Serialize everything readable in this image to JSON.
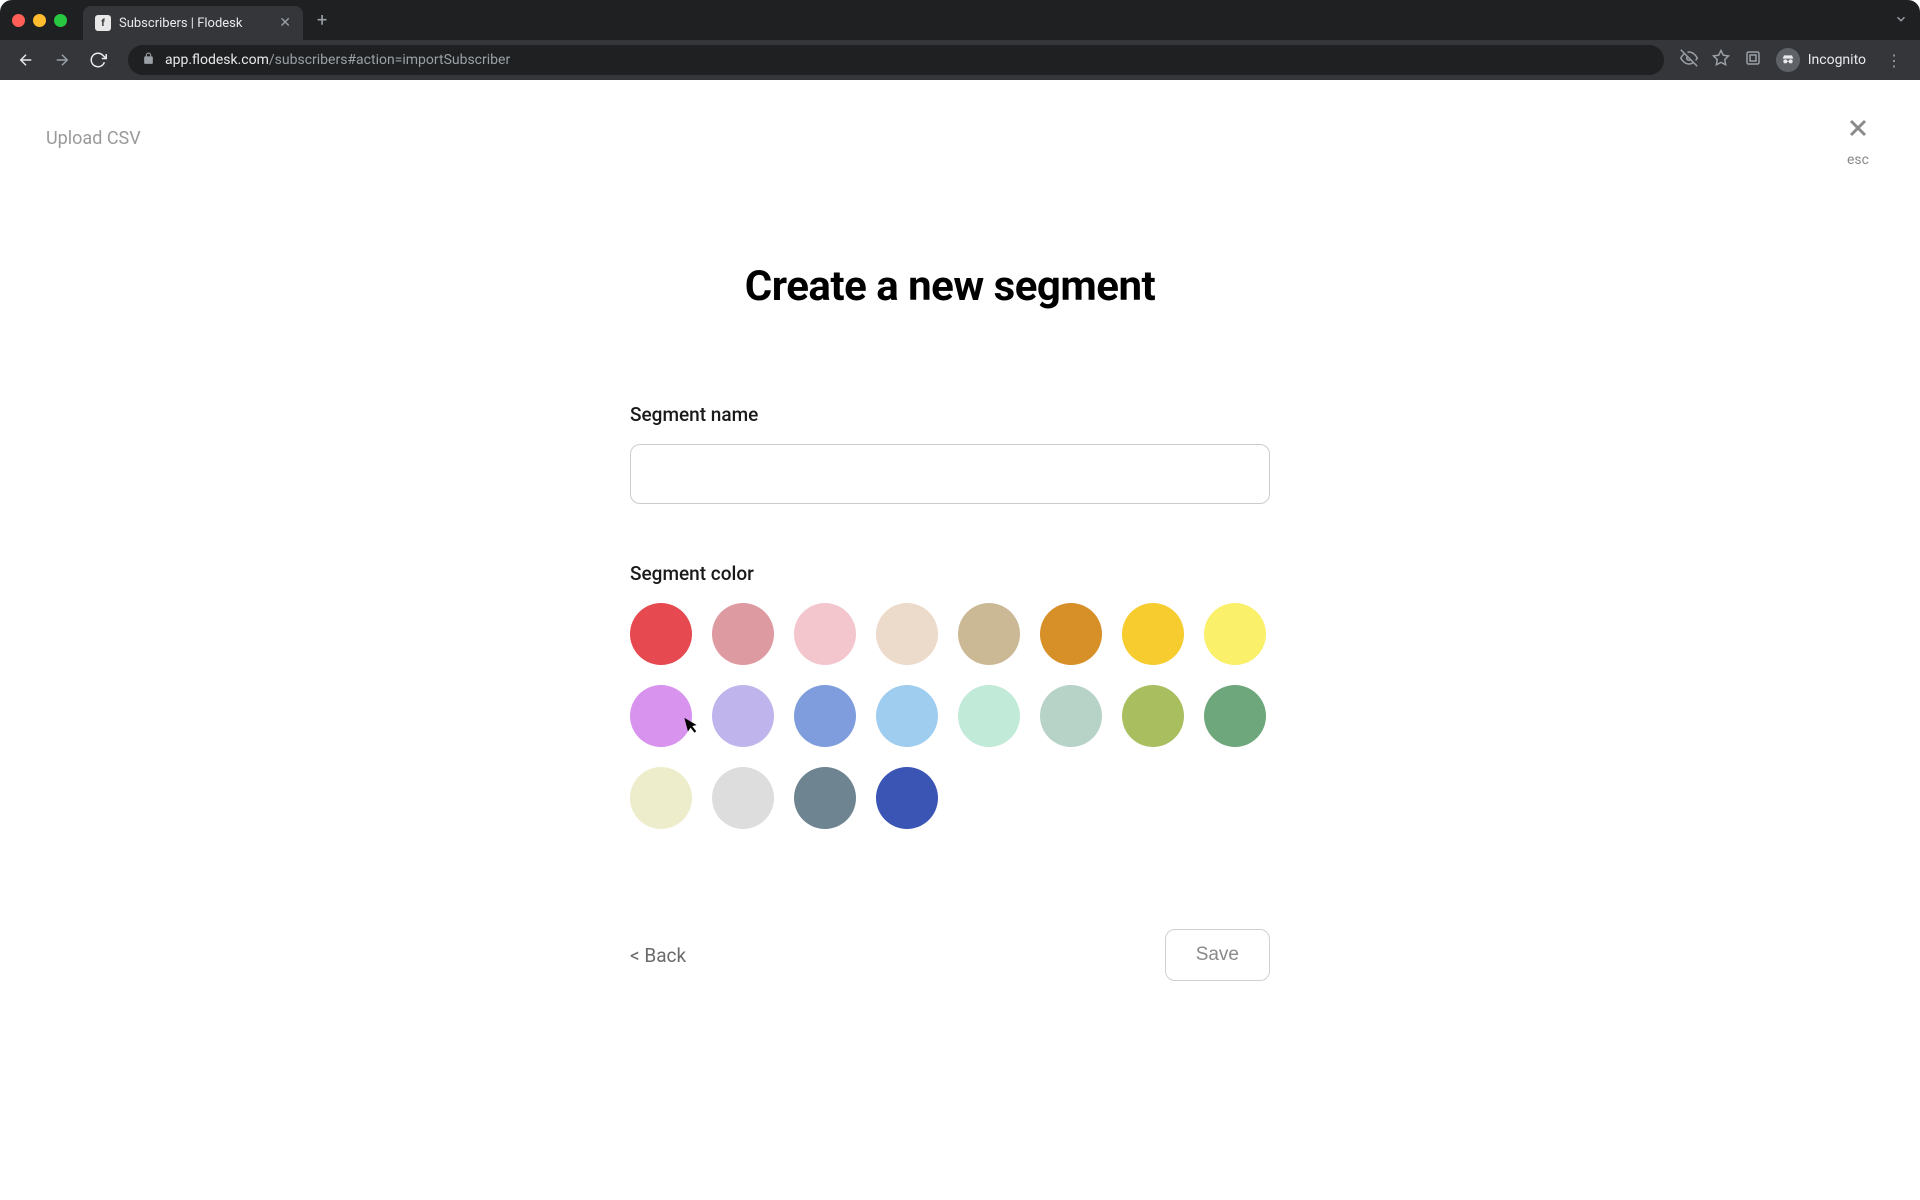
{
  "browser": {
    "tab_title": "Subscribers | Flodesk",
    "url_host": "app.flodesk.com",
    "url_path": "/subscribers#action=importSubscriber",
    "incognito_label": "Incognito"
  },
  "page": {
    "breadcrumb": "Upload CSV",
    "close_hint": "esc",
    "heading": "Create a new segment",
    "name_label": "Segment name",
    "name_value": "",
    "color_label": "Segment color",
    "colors": [
      "#e64a50",
      "#dd9aa0",
      "#f3c6ce",
      "#ecdacb",
      "#cbb995",
      "#d78f28",
      "#f6cc2f",
      "#faf06a",
      "#d893ee",
      "#bfb4ec",
      "#7f9ddd",
      "#9fcdef",
      "#c1ead8",
      "#b7d2c6",
      "#a9bf5f",
      "#6ea77c",
      "#edeccb",
      "#dddddd",
      "#6e8491",
      "#3b55b4"
    ],
    "back_label": "< Back",
    "save_label": "Save"
  }
}
